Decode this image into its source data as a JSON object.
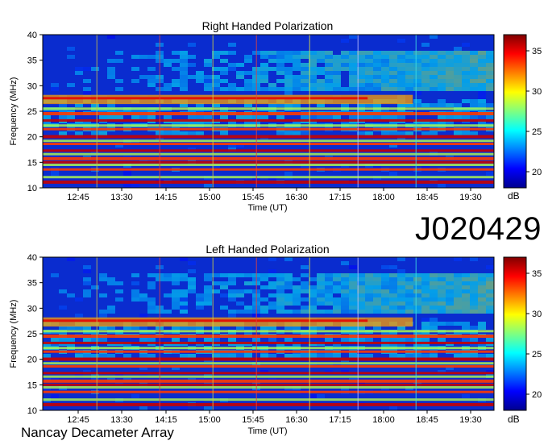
{
  "observation_id": "J020429",
  "footer": "Nancay Decameter Array",
  "chart_data": [
    {
      "type": "heatmap",
      "title": "Right Handed Polarization",
      "xlabel": "Time (UT)",
      "ylabel": "Frequency (MHz)",
      "x_ticks": [
        "12:45",
        "13:30",
        "14:15",
        "15:00",
        "15:45",
        "16:30",
        "17:15",
        "18:00",
        "18:45",
        "19:30"
      ],
      "y_ticks": [
        10,
        15,
        20,
        25,
        30,
        35,
        40
      ],
      "ylim": [
        10,
        40
      ],
      "colorbar": {
        "label": "dB",
        "ticks": [
          20,
          25,
          30,
          35
        ],
        "range": [
          18,
          37
        ]
      },
      "features": {
        "strong_bands_mhz": [
          11.2,
          13.6,
          15.0,
          15.8,
          17.3,
          18.6,
          20.1,
          21.5,
          23.2,
          24.6
        ],
        "moderate_bands_mhz": [
          12.1,
          14.5,
          16.6,
          19.2,
          22.2,
          25.5
        ],
        "broad_band_mhz": [
          26.4,
          28.2
        ],
        "vertical_lines_time": [
          "13:05",
          "14:10",
          "15:05",
          "15:50",
          "16:45",
          "17:35",
          "18:35"
        ]
      }
    },
    {
      "type": "heatmap",
      "title": "Left Handed Polarization",
      "xlabel": "Time (UT)",
      "ylabel": "Frequency (MHz)",
      "x_ticks": [
        "12:45",
        "13:30",
        "14:15",
        "15:00",
        "15:45",
        "16:30",
        "17:15",
        "18:00",
        "18:45",
        "19:30"
      ],
      "y_ticks": [
        10,
        15,
        20,
        25,
        30,
        35,
        40
      ],
      "ylim": [
        10,
        40
      ],
      "colorbar": {
        "label": "dB",
        "ticks": [
          20,
          25,
          30,
          35
        ],
        "range": [
          18,
          37
        ]
      },
      "features": {
        "strong_bands_mhz": [
          11.2,
          13.6,
          15.0,
          15.8,
          17.3,
          18.6,
          20.1,
          21.5,
          23.2,
          24.6
        ],
        "moderate_bands_mhz": [
          12.1,
          14.5,
          16.6,
          19.2,
          22.2,
          25.5
        ],
        "broad_band_mhz": [
          26.4,
          28.2
        ],
        "vertical_lines_time": [
          "13:05",
          "14:10",
          "15:05",
          "15:50",
          "16:45",
          "17:35",
          "18:35"
        ]
      }
    }
  ]
}
